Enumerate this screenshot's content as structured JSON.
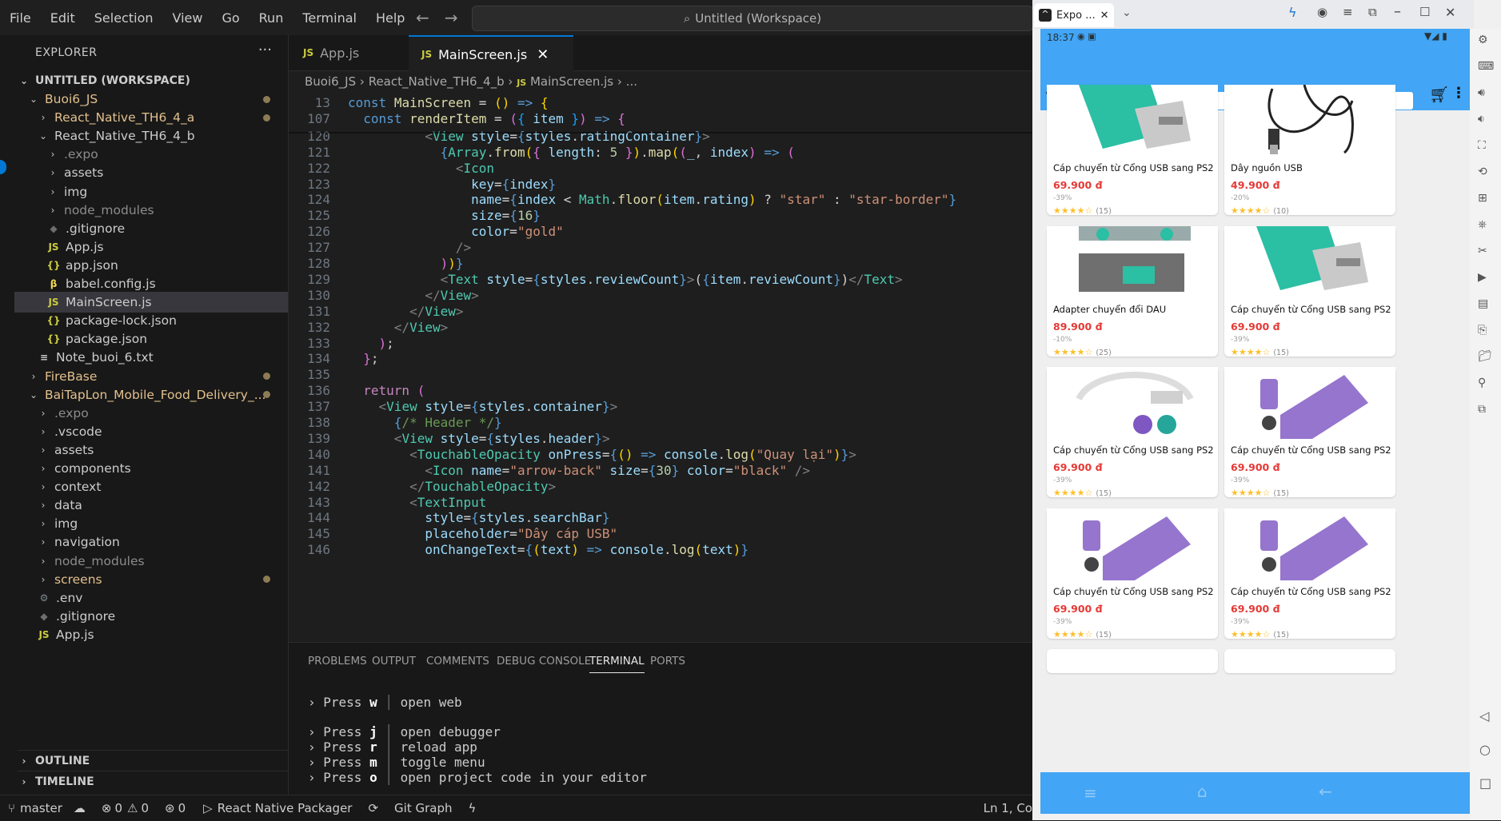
{
  "menu": [
    "File",
    "Edit",
    "Selection",
    "View",
    "Go",
    "Run",
    "Terminal",
    "Help"
  ],
  "command_center": "Untitled (Workspace)",
  "explorer": {
    "title": "EXPLORER",
    "workspace": "UNTITLED (WORKSPACE)",
    "items": [
      {
        "label": "Buoi6_JS",
        "type": "folder-open",
        "depth": 1,
        "color": "#e2c08d",
        "mod": true
      },
      {
        "label": "React_Native_TH6_4_a",
        "type": "folder",
        "depth": 2,
        "color": "#e2c08d",
        "mod": true
      },
      {
        "label": "React_Native_TH6_4_b",
        "type": "folder-open",
        "depth": 2,
        "color": "#cccccc",
        "mod": false
      },
      {
        "label": ".expo",
        "type": "folder",
        "depth": 3,
        "color": "#8c8c8c",
        "mod": false
      },
      {
        "label": "assets",
        "type": "folder",
        "depth": 3,
        "color": "#cccccc",
        "mod": false
      },
      {
        "label": "img",
        "type": "folder",
        "depth": 3,
        "color": "#cccccc",
        "mod": false
      },
      {
        "label": "node_modules",
        "type": "folder",
        "depth": 3,
        "color": "#8c8c8c",
        "mod": false
      },
      {
        "label": ".gitignore",
        "type": "file-git",
        "depth": 3,
        "color": "#cccccc",
        "mod": false
      },
      {
        "label": "App.js",
        "type": "file-js",
        "depth": 3,
        "color": "#cccccc",
        "mod": false
      },
      {
        "label": "app.json",
        "type": "file-json",
        "depth": 3,
        "color": "#cccccc",
        "mod": false
      },
      {
        "label": "babel.config.js",
        "type": "file-babel",
        "depth": 3,
        "color": "#cccccc",
        "mod": false
      },
      {
        "label": "MainScreen.js",
        "type": "file-js",
        "depth": 3,
        "color": "#cccccc",
        "mod": false,
        "selected": true
      },
      {
        "label": "package-lock.json",
        "type": "file-json",
        "depth": 3,
        "color": "#cccccc",
        "mod": false
      },
      {
        "label": "package.json",
        "type": "file-json",
        "depth": 3,
        "color": "#cccccc",
        "mod": false
      },
      {
        "label": "Note_buoi_6.txt",
        "type": "file-txt",
        "depth": 2,
        "color": "#cccccc",
        "mod": false
      },
      {
        "label": "FireBase",
        "type": "folder",
        "depth": 1,
        "color": "#e2c08d",
        "mod": true
      },
      {
        "label": "BaiTapLon_Mobile_Food_Delivery_...",
        "type": "folder-open",
        "depth": 1,
        "color": "#e2c08d",
        "mod": true
      },
      {
        "label": ".expo",
        "type": "folder",
        "depth": 2,
        "color": "#8c8c8c",
        "mod": false
      },
      {
        "label": ".vscode",
        "type": "folder",
        "depth": 2,
        "color": "#cccccc",
        "mod": false
      },
      {
        "label": "assets",
        "type": "folder",
        "depth": 2,
        "color": "#cccccc",
        "mod": false
      },
      {
        "label": "components",
        "type": "folder",
        "depth": 2,
        "color": "#cccccc",
        "mod": false
      },
      {
        "label": "context",
        "type": "folder",
        "depth": 2,
        "color": "#cccccc",
        "mod": false
      },
      {
        "label": "data",
        "type": "folder",
        "depth": 2,
        "color": "#cccccc",
        "mod": false
      },
      {
        "label": "img",
        "type": "folder",
        "depth": 2,
        "color": "#cccccc",
        "mod": false
      },
      {
        "label": "navigation",
        "type": "folder",
        "depth": 2,
        "color": "#cccccc",
        "mod": false
      },
      {
        "label": "node_modules",
        "type": "folder",
        "depth": 2,
        "color": "#8c8c8c",
        "mod": false
      },
      {
        "label": "screens",
        "type": "folder",
        "depth": 2,
        "color": "#e2c08d",
        "mod": true
      },
      {
        "label": ".env",
        "type": "file-gear",
        "depth": 2,
        "color": "#cccccc",
        "mod": false
      },
      {
        "label": ".gitignore",
        "type": "file-git",
        "depth": 2,
        "color": "#cccccc",
        "mod": false
      },
      {
        "label": "App.js",
        "type": "file-js",
        "depth": 2,
        "color": "#cccccc",
        "mod": false
      }
    ],
    "outline": "OUTLINE",
    "timeline": "TIMELINE"
  },
  "tabs": [
    {
      "label": "App.js",
      "active": false
    },
    {
      "label": "MainScreen.js",
      "active": true
    }
  ],
  "breadcrumb": [
    "Buoi6_JS",
    "React_Native_TH6_4_b",
    "MainScreen.js",
    "..."
  ],
  "code_lines": [
    {
      "n": "13",
      "html": "<span class='k'>const</span> <span class='f'>MainScreen</span> <span class='p'>=</span> <span class='y'>()</span> <span class='k'>=&gt;</span> <span class='y'>{</span>"
    },
    {
      "n": "107",
      "html": "  <span class='k'>const</span> <span class='f'>renderItem</span> <span class='p'>=</span> <span class='pu'>(</span><span class='bl'>{</span> <span class='v'>item</span> <span class='bl'>}</span><span class='pu'>)</span> <span class='k'>=&gt;</span> <span class='pu'>{</span>"
    },
    {
      "n": "120",
      "html": "          <span class='g'>&lt;</span><span class='t'>View</span> <span class='v'>style</span><span class='p'>=</span><span class='k'>{</span><span class='v'>styles</span>.<span class='v'>ratingContainer</span><span class='k'>}</span><span class='g'>&gt;</span>"
    },
    {
      "n": "121",
      "html": "            <span class='k'>{</span><span class='t'>Array</span>.<span class='f'>from</span><span class='y'>(</span><span class='pu'>{</span> <span class='v'>length</span>: <span class='n'>5</span> <span class='pu'>}</span><span class='y'>)</span>.<span class='f'>map</span><span class='y'>(</span><span class='pu'>(</span><span class='v'>_</span>, <span class='v'>index</span><span class='pu'>)</span> <span class='k'>=&gt;</span> <span class='pu'>(</span>"
    },
    {
      "n": "122",
      "html": "              <span class='g'>&lt;</span><span class='t'>Icon</span>"
    },
    {
      "n": "123",
      "html": "                <span class='v'>key</span><span class='p'>=</span><span class='k'>{</span><span class='v'>index</span><span class='k'>}</span>"
    },
    {
      "n": "124",
      "html": "                <span class='v'>name</span><span class='p'>=</span><span class='k'>{</span><span class='v'>index</span> <span class='p'>&lt;</span> <span class='t'>Math</span>.<span class='f'>floor</span><span class='y'>(</span><span class='v'>item</span>.<span class='v'>rating</span><span class='y'>)</span> <span class='p'>?</span> <span class='s'>\"star\"</span> <span class='p'>:</span> <span class='s'>\"star-border\"</span><span class='k'>}</span>"
    },
    {
      "n": "125",
      "html": "                <span class='v'>size</span><span class='p'>=</span><span class='k'>{</span><span class='n'>16</span><span class='k'>}</span>"
    },
    {
      "n": "126",
      "html": "                <span class='v'>color</span><span class='p'>=</span><span class='s'>\"gold\"</span>"
    },
    {
      "n": "127",
      "html": "              <span class='g'>/&gt;</span>"
    },
    {
      "n": "128",
      "html": "            <span class='pu'>)</span><span class='y'>)</span><span class='k'>}</span>"
    },
    {
      "n": "129",
      "html": "            <span class='g'>&lt;</span><span class='t'>Text</span> <span class='v'>style</span><span class='p'>=</span><span class='k'>{</span><span class='v'>styles</span>.<span class='v'>reviewCount</span><span class='k'>}</span><span class='g'>&gt;</span><span class='p'>(</span><span class='k'>{</span><span class='v'>item</span>.<span class='v'>reviewCount</span><span class='k'>}</span><span class='p'>)</span><span class='g'>&lt;/</span><span class='t'>Text</span><span class='g'>&gt;</span>"
    },
    {
      "n": "130",
      "html": "          <span class='g'>&lt;/</span><span class='t'>View</span><span class='g'>&gt;</span>"
    },
    {
      "n": "131",
      "html": "        <span class='g'>&lt;/</span><span class='t'>View</span><span class='g'>&gt;</span>"
    },
    {
      "n": "132",
      "html": "      <span class='g'>&lt;/</span><span class='t'>View</span><span class='g'>&gt;</span>"
    },
    {
      "n": "133",
      "html": "    <span class='pu'>)</span>;"
    },
    {
      "n": "134",
      "html": "  <span class='pu'>}</span>;"
    },
    {
      "n": "135",
      "html": ""
    },
    {
      "n": "136",
      "html": "  <span class='kw2'>return</span> <span class='pu'>(</span>"
    },
    {
      "n": "137",
      "html": "    <span class='g'>&lt;</span><span class='t'>View</span> <span class='v'>style</span><span class='p'>=</span><span class='k'>{</span><span class='v'>styles</span>.<span class='v'>container</span><span class='k'>}</span><span class='g'>&gt;</span>"
    },
    {
      "n": "138",
      "html": "      <span class='k'>{</span><span class='c'>/* Header */</span><span class='k'>}</span>"
    },
    {
      "n": "139",
      "html": "      <span class='g'>&lt;</span><span class='t'>View</span> <span class='v'>style</span><span class='p'>=</span><span class='k'>{</span><span class='v'>styles</span>.<span class='v'>header</span><span class='k'>}</span><span class='g'>&gt;</span>"
    },
    {
      "n": "140",
      "html": "        <span class='g'>&lt;</span><span class='t'>TouchableOpacity</span> <span class='v'>onPress</span><span class='p'>=</span><span class='k'>{</span><span class='y'>()</span> <span class='k'>=&gt;</span> <span class='v'>console</span>.<span class='f'>log</span><span class='y'>(</span><span class='s'>\"Quay lại\"</span><span class='y'>)</span><span class='k'>}</span><span class='g'>&gt;</span>"
    },
    {
      "n": "141",
      "html": "          <span class='g'>&lt;</span><span class='t'>Icon</span> <span class='v'>name</span><span class='p'>=</span><span class='s'>\"arrow-back\"</span> <span class='v'>size</span><span class='p'>=</span><span class='k'>{</span><span class='n'>30</span><span class='k'>}</span> <span class='v'>color</span><span class='p'>=</span><span class='s'>\"black\"</span> <span class='g'>/&gt;</span>"
    },
    {
      "n": "142",
      "html": "        <span class='g'>&lt;/</span><span class='t'>TouchableOpacity</span><span class='g'>&gt;</span>"
    },
    {
      "n": "143",
      "html": "        <span class='g'>&lt;</span><span class='t'>TextInput</span>"
    },
    {
      "n": "144",
      "html": "          <span class='v'>style</span><span class='p'>=</span><span class='k'>{</span><span class='v'>styles</span>.<span class='v'>searchBar</span><span class='k'>}</span>"
    },
    {
      "n": "145",
      "html": "          <span class='v'>placeholder</span><span class='p'>=</span><span class='s'>\"Dây cáp USB\"</span>"
    },
    {
      "n": "146",
      "html": "          <span class='v'>onChangeText</span><span class='p'>=</span><span class='k'>{</span><span class='y'>(</span><span class='v'>text</span><span class='y'>)</span> <span class='k'>=&gt;</span> <span class='v'>console</span>.<span class='f'>log</span><span class='y'>(</span><span class='v'>text</span><span class='y'>)</span><span class='k'>}</span>"
    }
  ],
  "panel_tabs": [
    "PROBLEMS",
    "OUTPUT",
    "COMMENTS",
    "DEBUG CONSOLE",
    "TERMINAL",
    "PORTS"
  ],
  "terminal": [
    {
      "prefix": "› Press ",
      "key": "w",
      "text": "open web"
    },
    {
      "prefix": "› Press ",
      "key": "j",
      "text": "open debugger"
    },
    {
      "prefix": "› Press ",
      "key": "r",
      "text": "reload app"
    },
    {
      "prefix": "› Press ",
      "key": "m",
      "text": "toggle menu"
    },
    {
      "prefix": "› Press ",
      "key": "o",
      "text": "open project code in your editor"
    }
  ],
  "statusbar": {
    "branch": "master",
    "errors": "0",
    "warnings": "0",
    "ports": "0",
    "packager": "React Native Packager",
    "gitgraph": "Git Graph",
    "cursor": "Ln 1, Co"
  },
  "emulator": {
    "window_tab": "Expo ...",
    "time": "18:37",
    "search_placeholder": "Dây cáp USB",
    "products": [
      {
        "name": "Cáp chuyển từ Cổng USB sang PS2",
        "price": "69.900 đ",
        "discount": "-39%",
        "stars": "★★★★☆",
        "reviews": "(15)",
        "img": "green-adapter"
      },
      {
        "name": "Dây nguồn USB",
        "price": "49.900 đ",
        "discount": "-20%",
        "stars": "★★★★☆",
        "reviews": "(10)",
        "img": "cable"
      },
      {
        "name": "Adapter chuyển đổi DAU",
        "price": "89.900 đ",
        "discount": "-10%",
        "stars": "★★★★☆",
        "reviews": "(25)",
        "img": "adapter-photo"
      },
      {
        "name": "Cáp chuyển từ Cổng USB sang PS2",
        "price": "69.900 đ",
        "discount": "-39%",
        "stars": "★★★★☆",
        "reviews": "(15)",
        "img": "green-adapter"
      },
      {
        "name": "Cáp chuyển từ Cổng USB sang PS2",
        "price": "69.900 đ",
        "discount": "-39%",
        "stars": "★★★★☆",
        "reviews": "(15)",
        "img": "y-cable"
      },
      {
        "name": "Cáp chuyển từ Cổng USB sang PS2",
        "price": "69.900 đ",
        "discount": "-39%",
        "stars": "★★★★☆",
        "reviews": "(15)",
        "img": "purple-adapter"
      },
      {
        "name": "Cáp chuyển từ Cổng USB sang PS2",
        "price": "69.900 đ",
        "discount": "-39%",
        "stars": "★★★★☆",
        "reviews": "(15)",
        "img": "purple-adapter"
      },
      {
        "name": "Cáp chuyển từ Cổng USB sang PS2",
        "price": "69.900 đ",
        "discount": "-39%",
        "stars": "★★★★☆",
        "reviews": "(15)",
        "img": "purple-adapter"
      }
    ]
  }
}
